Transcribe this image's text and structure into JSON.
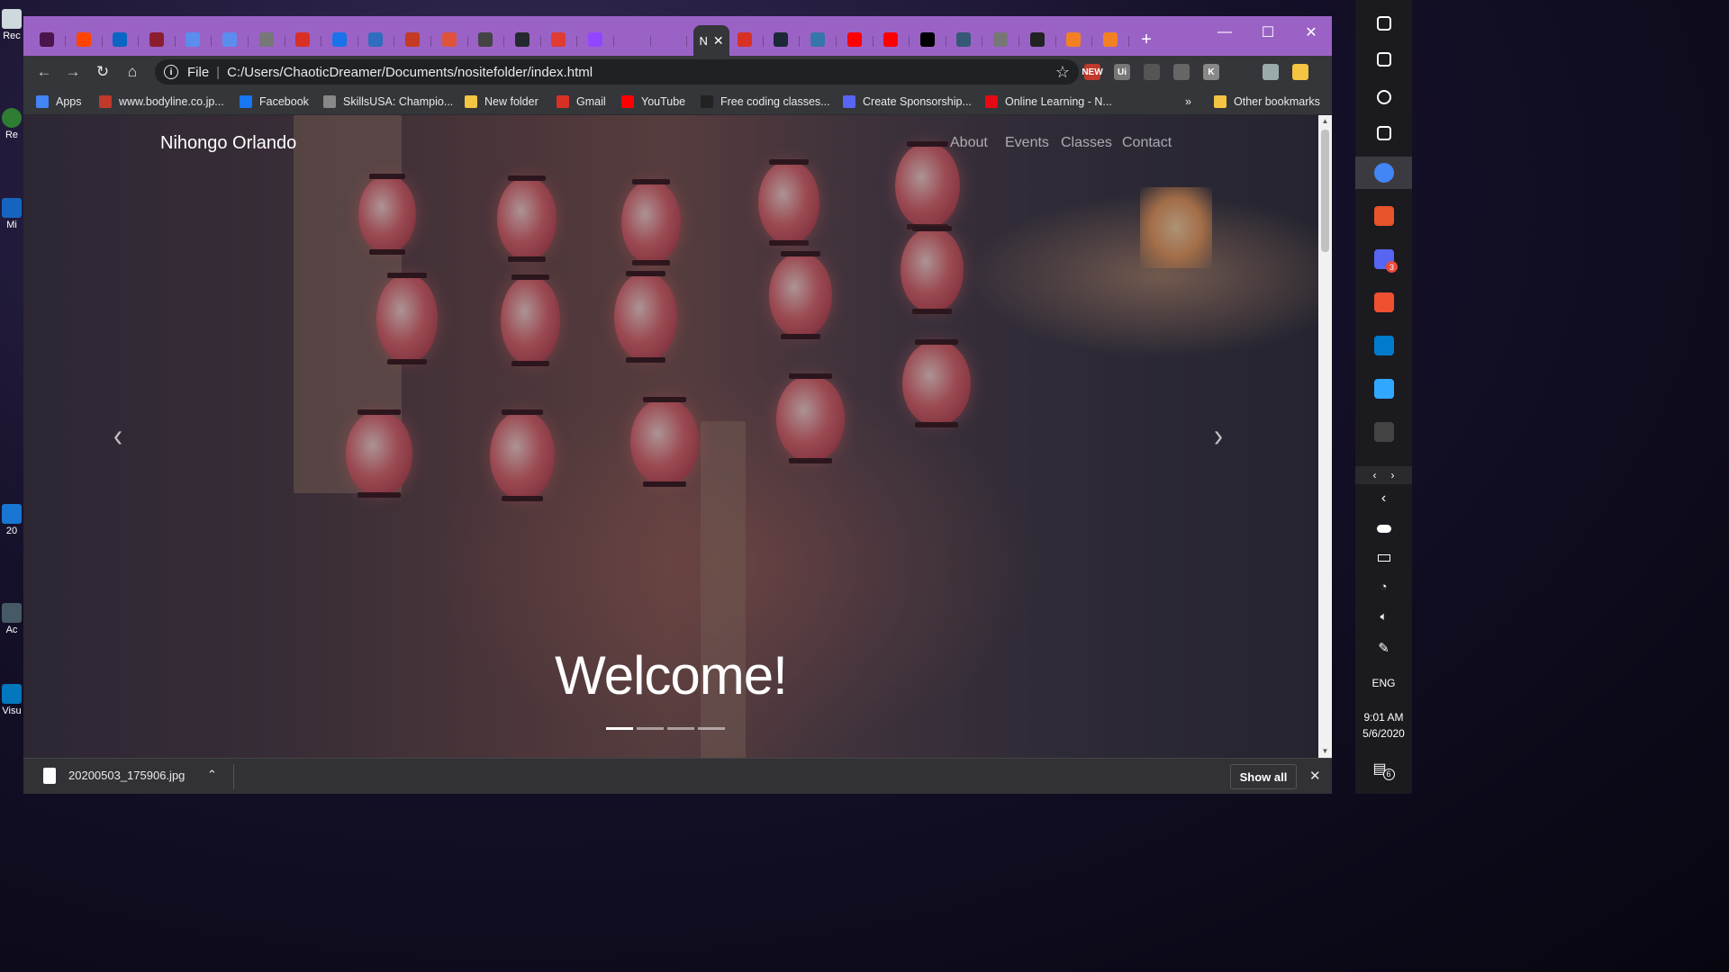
{
  "browser": {
    "address": {
      "scheme_label": "File",
      "url": "C:/Users/ChaoticDreamer/Documents/nositefolder/index.html"
    },
    "tabs": [
      {
        "icon": "slack-icon",
        "color": "#4a154b"
      },
      {
        "icon": "reddit-icon",
        "color": "#ff4500"
      },
      {
        "icon": "linkedin-icon",
        "color": "#0a66c2"
      },
      {
        "icon": "shield-icon",
        "color": "#8b1e2e"
      },
      {
        "icon": "link-icon",
        "color": "#5b8def"
      },
      {
        "icon": "link-icon",
        "color": "#5b8def"
      },
      {
        "icon": "globe-icon",
        "color": "#777777"
      },
      {
        "icon": "gmail-icon",
        "color": "#d93025"
      },
      {
        "icon": "w-icon",
        "color": "#1a73e8"
      },
      {
        "icon": "wp-icon",
        "color": "#2f6dbf"
      },
      {
        "icon": "grid-icon",
        "color": "#c23b22"
      },
      {
        "icon": "ux-icon",
        "color": "#e0533b"
      },
      {
        "icon": "doc-icon",
        "color": "#444444"
      },
      {
        "icon": "github-icon",
        "color": "#24292e"
      },
      {
        "icon": "circle-icon",
        "color": "#e03c31"
      },
      {
        "icon": "twitch-icon",
        "color": "#9146ff"
      },
      {
        "icon": "blank-icon",
        "color": "#9b62c6"
      },
      {
        "icon": "blank-icon",
        "color": "#9b62c6"
      },
      {
        "icon": "gmail-icon",
        "color": "#d93025"
      },
      {
        "icon": "steam-icon",
        "color": "#1b2838"
      },
      {
        "icon": "python-icon",
        "color": "#3776ab"
      },
      {
        "icon": "youtube-icon",
        "color": "#ff0000"
      },
      {
        "icon": "youtube-icon",
        "color": "#ff0000"
      },
      {
        "icon": "medium-icon",
        "color": "#000000"
      },
      {
        "icon": "tds-icon",
        "color": "#355876"
      },
      {
        "icon": "globe-icon",
        "color": "#777777"
      },
      {
        "icon": "b-icon",
        "color": "#222222"
      },
      {
        "icon": "stack-icon",
        "color": "#f48024"
      },
      {
        "icon": "stack-icon",
        "color": "#f48024"
      }
    ],
    "active_tab": {
      "label": "N"
    },
    "new_tab_label": "+",
    "extensions": [
      {
        "icon": "star-icon"
      },
      {
        "icon": "new-badge-icon",
        "label": "NEW"
      },
      {
        "icon": "ui-icon",
        "label": "Ui"
      },
      {
        "icon": "circle-icon"
      },
      {
        "icon": "record-icon"
      },
      {
        "icon": "k-icon",
        "label": "K"
      },
      {
        "icon": "playlist-icon"
      },
      {
        "icon": "avatar-icon"
      },
      {
        "icon": "coin-icon"
      }
    ],
    "bookmarks": [
      {
        "icon": "apps-icon",
        "label": "Apps",
        "color": "#4285f4"
      },
      {
        "icon": "bodyline-icon",
        "label": "www.bodyline.co.jp...",
        "color": "#c0392b"
      },
      {
        "icon": "facebook-icon",
        "label": "Facebook",
        "color": "#1877f2"
      },
      {
        "icon": "skillsusa-icon",
        "label": "SkillsUSA: Champio...",
        "color": "#888888"
      },
      {
        "icon": "folder-icon",
        "label": "New folder",
        "color": "#f4c542"
      },
      {
        "icon": "gmail-icon",
        "label": "Gmail",
        "color": "#d93025"
      },
      {
        "icon": "youtube-icon",
        "label": "YouTube",
        "color": "#ff0000"
      },
      {
        "icon": "bi-icon",
        "label": "Free coding classes...",
        "color": "#222222"
      },
      {
        "icon": "patreon-icon",
        "label": "Create Sponsorship...",
        "color": "#5865f2"
      },
      {
        "icon": "netflix-icon",
        "label": "Online Learning - N...",
        "color": "#e50914"
      }
    ],
    "bookmarks_overflow": "»",
    "other_bookmarks": "Other bookmarks"
  },
  "site": {
    "brand": "Nihongo Orlando",
    "nav": [
      "About",
      "Events",
      "Classes",
      "Contact"
    ],
    "prev_glyph": "‹",
    "next_glyph": "›",
    "welcome": "Welcome!",
    "carousel_slides": 4,
    "carousel_active": 1
  },
  "downloads": {
    "file": "20200503_175906.jpg",
    "show_all": "Show all",
    "close": "✕"
  },
  "desktop_icons": [
    "Rec",
    "Re",
    "Mi",
    "20",
    "Ac",
    "Visu"
  ],
  "taskbar": {
    "language": "ENG",
    "time": "9:01 AM",
    "date": "5/6/2020",
    "notification_count": "6",
    "discord_badge": "3",
    "apps": [
      {
        "icon": "windows-icon"
      },
      {
        "icon": "search-icon"
      },
      {
        "icon": "cortana-icon"
      },
      {
        "icon": "task-view-icon"
      },
      {
        "icon": "chrome-icon",
        "color": "#4285f4"
      },
      {
        "icon": "speaker-app-icon",
        "color": "#e8542b"
      },
      {
        "icon": "discord-icon",
        "color": "#5865f2"
      },
      {
        "icon": "git-icon",
        "color": "#f05032"
      },
      {
        "icon": "vscode-icon",
        "color": "#007acc"
      },
      {
        "icon": "photoshop-icon",
        "color": "#31a8ff"
      },
      {
        "icon": "terminal-icon",
        "color": "#444444"
      }
    ]
  }
}
